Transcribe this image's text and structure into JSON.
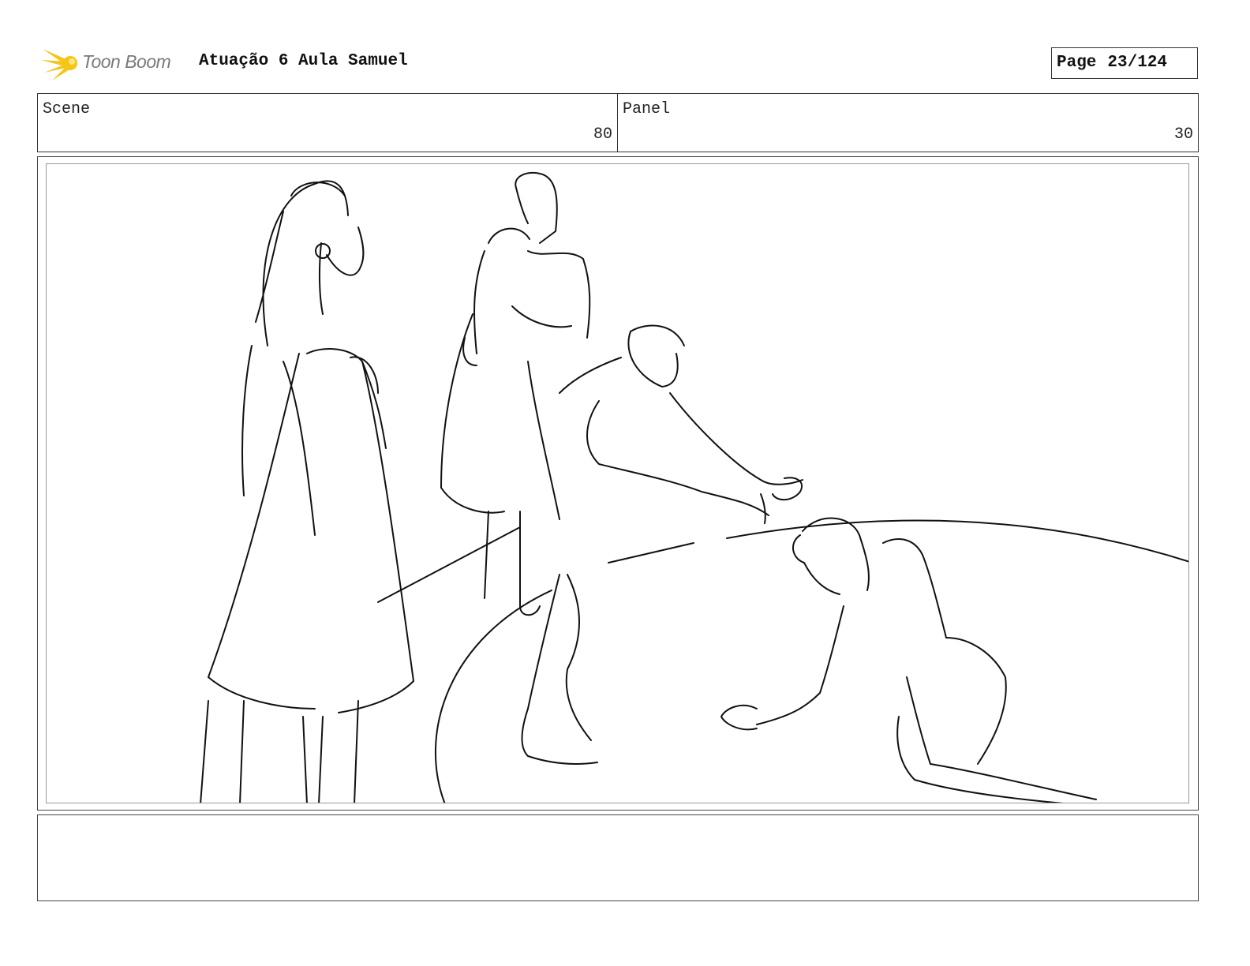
{
  "header": {
    "logo": {
      "brand": "Toon Boom",
      "icon": "toon-boom-star-icon",
      "star_color": "#F5C518"
    },
    "title": "Atuação 6 Aula Samuel",
    "page_label": "Page",
    "page_number": "23/124"
  },
  "info": {
    "scene": {
      "label": "Scene",
      "value": "80"
    },
    "panel": {
      "label": "Panel",
      "value": "30"
    }
  },
  "drawing": {
    "icon": "storyboard-sketch-image"
  },
  "notes": {
    "text": ""
  }
}
